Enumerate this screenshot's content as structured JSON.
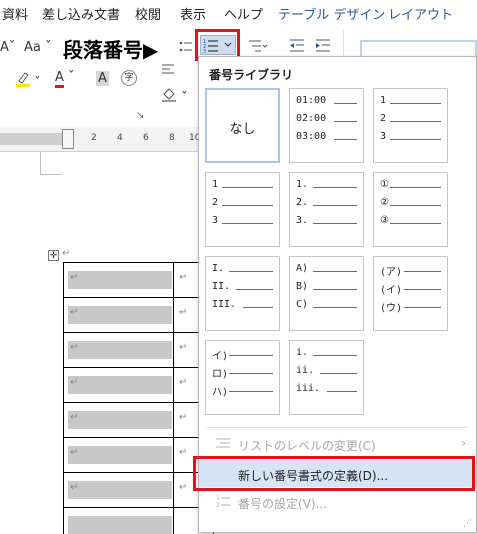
{
  "tabs": [
    {
      "label": "資料",
      "color": "normal"
    },
    {
      "label": "差し込み文書",
      "color": "normal"
    },
    {
      "label": "校閲",
      "color": "normal"
    },
    {
      "label": "表示",
      "color": "normal"
    },
    {
      "label": "ヘルプ",
      "color": "normal"
    },
    {
      "label": "テーブル デザイン",
      "color": "blue"
    },
    {
      "label": "レイアウト",
      "color": "blue"
    }
  ],
  "ribbon": {
    "font_size_label": "A",
    "change_case_label": "Aa",
    "annotation": "段落番号▶",
    "highlight_icon": "highlighter-icon",
    "font_color_label": "A",
    "char_shading_label": "A",
    "enclose_char_label": "字",
    "shading_icon": "paint-bucket-icon",
    "dialog_launcher": "↘"
  },
  "ruler": {
    "numbers": [
      "2",
      "4",
      "6",
      "8",
      "10"
    ]
  },
  "panel": {
    "title": "番号ライブラリ",
    "tiles": [
      {
        "type": "none",
        "label": "なし"
      },
      {
        "lines": [
          "01:00",
          "02:00",
          "03:00"
        ]
      },
      {
        "lines": [
          "1",
          "2",
          "3"
        ]
      },
      {
        "lines": [
          "1",
          "2",
          "3"
        ]
      },
      {
        "lines": [
          "1.",
          "2.",
          "3."
        ]
      },
      {
        "lines": [
          "①",
          "②",
          "③"
        ]
      },
      {
        "lines": [
          "I.",
          "II.",
          "III."
        ]
      },
      {
        "lines": [
          "A)",
          "B)",
          "C)"
        ]
      },
      {
        "lines": [
          "(ア)",
          "(イ)",
          "(ウ)"
        ]
      },
      {
        "lines": [
          "イ)",
          "ロ)",
          "ハ)"
        ]
      },
      {
        "lines": [
          "i.",
          "ii.",
          "iii."
        ]
      }
    ],
    "menu": [
      {
        "label": "リストのレベルの変更(C)",
        "enabled": false,
        "icon": "list-level-icon"
      },
      {
        "label": "新しい番号書式の定義(D)...",
        "enabled": true,
        "icon": ""
      },
      {
        "label": "番号の設定(V)...",
        "enabled": false,
        "icon": "numbering-value-icon"
      }
    ]
  },
  "colors": {
    "accent": "#2b579a",
    "highlight_red": "#e8101a",
    "menu_hover": "#d7e4f5"
  }
}
